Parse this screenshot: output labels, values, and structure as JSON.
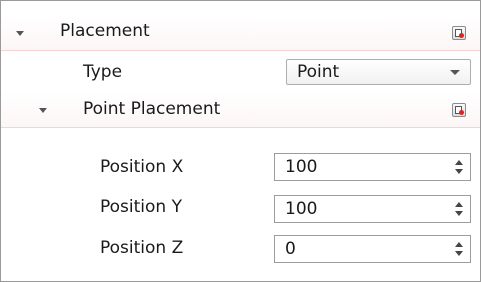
{
  "placement": {
    "label": "Placement",
    "reset_icon": "reset-default-icon",
    "type": {
      "label": "Type",
      "value": "Point"
    },
    "point_placement": {
      "label": "Point Placement",
      "reset_icon": "reset-default-icon",
      "position_x": {
        "label": "Position X",
        "value": "100"
      },
      "position_y": {
        "label": "Position Y",
        "value": "100"
      },
      "position_z": {
        "label": "Position Z",
        "value": "0"
      }
    }
  },
  "colors": {
    "header_divider": "#f3d3d3",
    "border": "#9a9a9a",
    "text": "#1a1a1a"
  }
}
